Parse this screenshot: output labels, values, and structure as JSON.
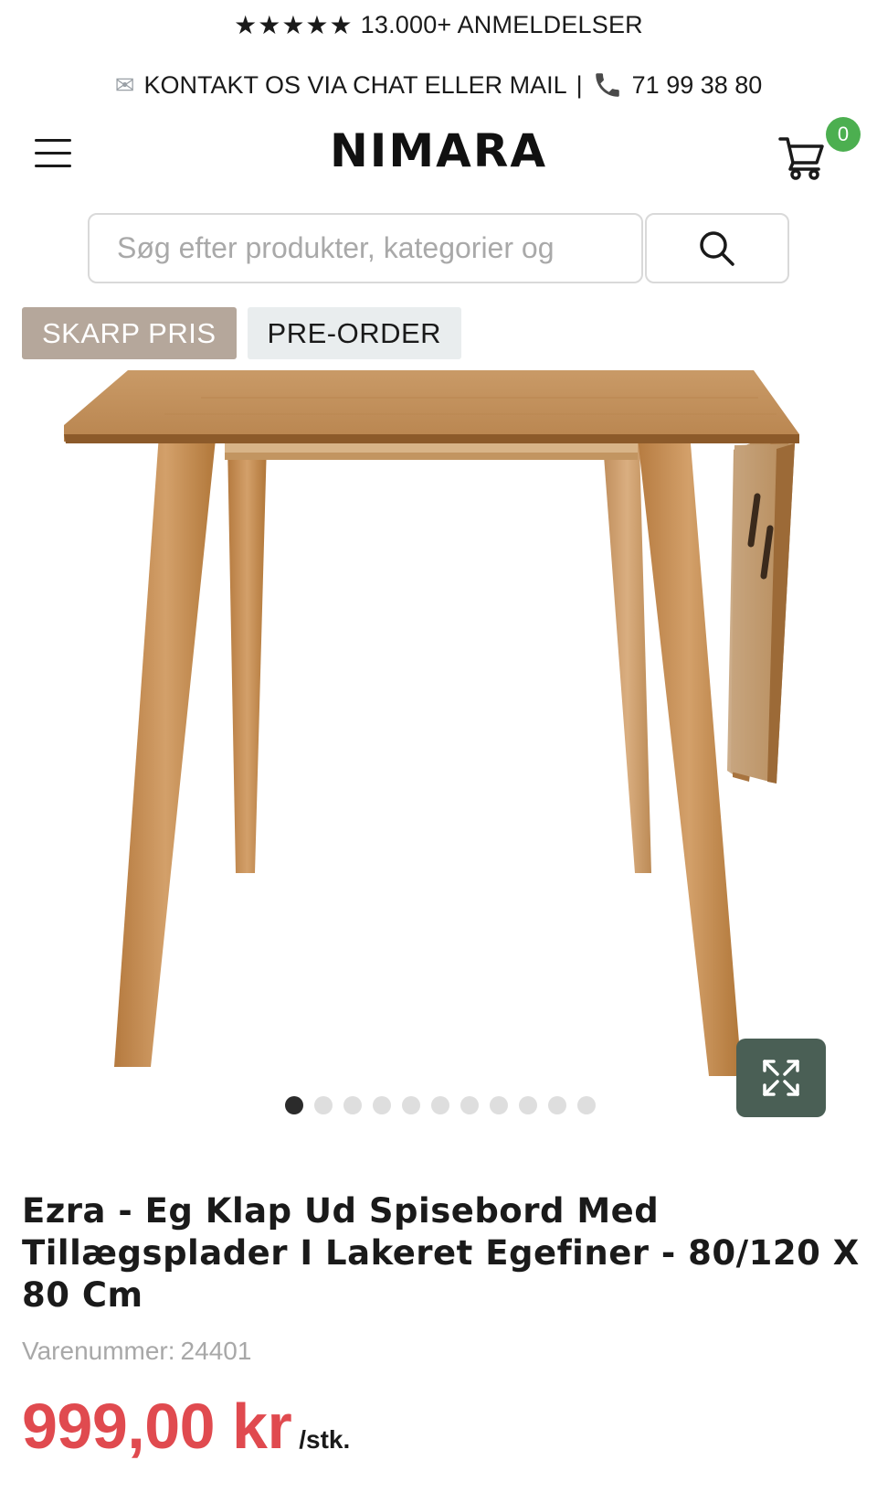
{
  "topbar": {
    "stars": "★★★★★",
    "reviews_text": "13.000+ ANMELDELSER",
    "contact_text": "KONTAKT OS VIA CHAT ELLER MAIL",
    "separator": "|",
    "phone": "71 99 38 80"
  },
  "header": {
    "logo": "NIMARA",
    "cart_count": "0",
    "icons": {
      "menu": "hamburger-menu-icon",
      "cart": "shopping-cart-icon"
    }
  },
  "search": {
    "placeholder": "Søg efter produkter, kategorier og",
    "value": ""
  },
  "badges": {
    "price_label": "SKARP PRIS",
    "preorder_label": "PRE-ORDER"
  },
  "gallery": {
    "image_count": 11,
    "active_index": 0
  },
  "product": {
    "title": "Ezra - Eg Klap Ud Spisebord Med Tillægsplader I Lakeret Egefiner - 80/120 X 80 Cm",
    "sku_label": "Varenummer:",
    "sku": "24401",
    "price": "999,00 kr",
    "unit": "/stk."
  },
  "colors": {
    "accent_green": "#4caf50",
    "price_red": "#e04a4f",
    "badge_taupe": "#b5a79b",
    "expand_button": "#4a5f55"
  }
}
